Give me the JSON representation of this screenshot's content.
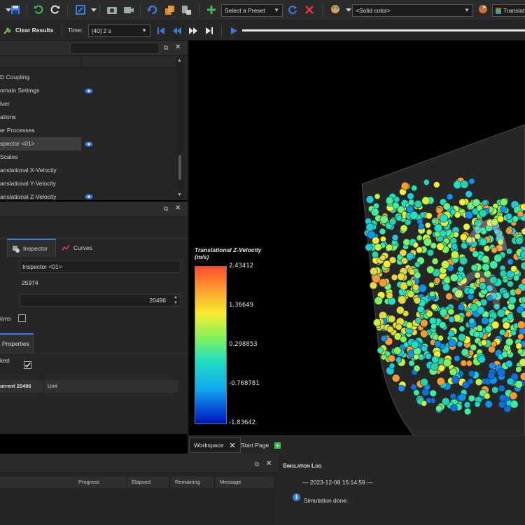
{
  "toolbar": {
    "preset_select": "Select a Preset",
    "color_select": "<Solid color>",
    "right_truncated": "Translat",
    "clear_results": "Clear Results",
    "time_label": "Time:",
    "time_value": "[40] 2 s"
  },
  "tree": {
    "items": [
      {
        "label": "D Coupling",
        "visible": false
      },
      {
        "label": "omain Settings",
        "visible": true
      },
      {
        "label": "lver",
        "visible": false
      },
      {
        "label": "ations",
        "visible": false
      },
      {
        "label": "er Processes",
        "visible": false
      },
      {
        "label": "spector <01>",
        "visible": true,
        "selected": true
      },
      {
        "label": "Scales",
        "visible": false
      },
      {
        "label": "anslational X-Velocity",
        "visible": false
      },
      {
        "label": "anslational Y-Velocity",
        "visible": false
      },
      {
        "label": "anslational Z-Velocity",
        "visible": true
      }
    ]
  },
  "inspector": {
    "tab_inspector": "Inspector",
    "tab_curves": "Curves",
    "name_value": "Inspector <01>",
    "count_value": "25974",
    "spin_value": "20496",
    "options_label": "ions",
    "properties_tab": "Properties",
    "checked_label": "ked",
    "col_current": "urrent 20496",
    "col_unit": "Unit"
  },
  "legend": {
    "title": "Translational Z-Velocity",
    "unit": "(m/s)",
    "max": "2.43412",
    "v2": "1.36649",
    "v3": "0.298853",
    "v4": "-0.768781",
    "min": "-1.83642"
  },
  "doc_tabs": {
    "workspace": "Workspace",
    "start_page": "Start Page"
  },
  "progress_table": {
    "columns": [
      "Progress",
      "Elapsed",
      "Remaining",
      "Message"
    ]
  },
  "sim_log": {
    "title": "Simulation Log",
    "timestamp_line": "— 2023-12-08 15:14:59 —",
    "message": "Simulation done."
  },
  "colors": {
    "accent_blue": "#3b7dde",
    "green_add": "#3fbf4f",
    "red_x": "#e03a3a"
  }
}
